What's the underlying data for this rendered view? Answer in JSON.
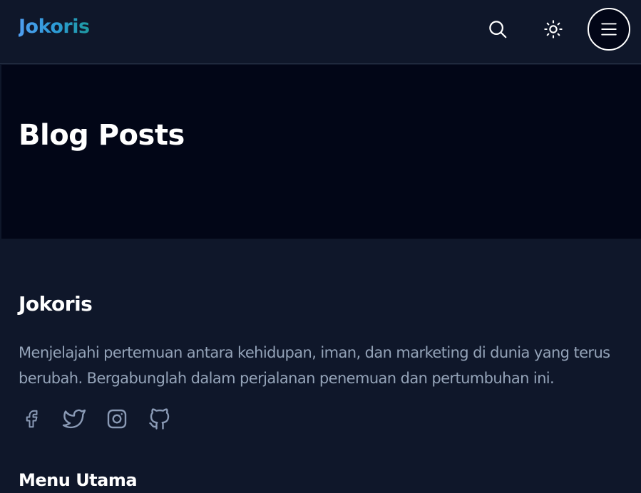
{
  "header": {
    "brand": "Jokoris",
    "icons": [
      "search-icon",
      "sun-icon",
      "menu-icon"
    ]
  },
  "hero": {
    "title": "Blog Posts"
  },
  "footer": {
    "brand": "Jokoris",
    "description": "Menjelajahi pertemuan antara kehidupan, iman, dan marketing di dunia yang terus berubah. Bergabunglah dalam perjalanan penemuan dan pertumbuhan ini.",
    "socials": [
      "facebook-icon",
      "twitter-icon",
      "instagram-icon",
      "github-icon"
    ],
    "menu_heading": "Menu Utama"
  },
  "colors": {
    "background": "#0f172a",
    "hero_background": "#020617",
    "muted_text": "#94a3b8",
    "icon_stroke": "#8a9ab5",
    "brand_gradient_start": "#4f9ef0",
    "brand_gradient_end": "#1e9aa0"
  }
}
